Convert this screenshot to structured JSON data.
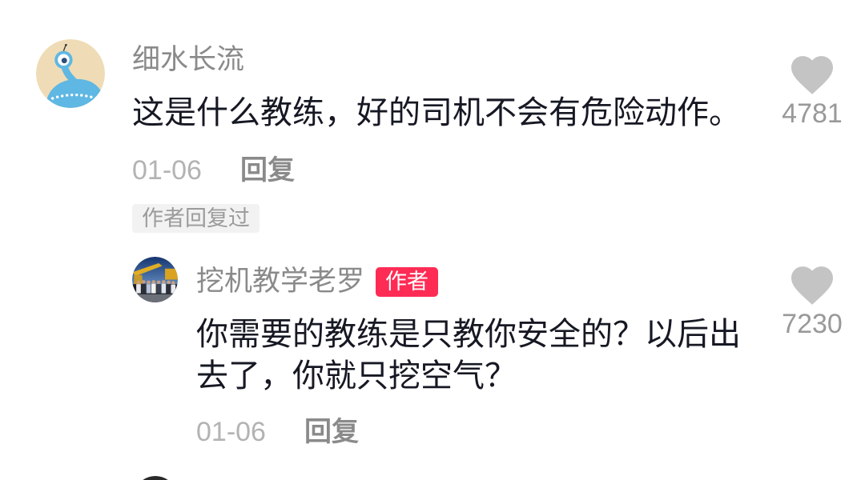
{
  "comments": [
    {
      "username": "细水长流",
      "text": "这是什么教练，好的司机不会有危险动作。",
      "date": "01-06",
      "reply_button_label": "回复",
      "like_count": "4781",
      "author_replied_tag": "作者回复过",
      "replies": [
        {
          "username": "挖机教学老罗",
          "author_badge": "作者",
          "text": "你需要的教练是只教你安全的？以后出去了，你就只挖空气？",
          "date": "01-06",
          "reply_button_label": "回复",
          "like_count": "7230"
        }
      ]
    }
  ],
  "icons": {
    "like": "heart-icon"
  },
  "colors": {
    "background": "#ffffff",
    "text_primary": "#161823",
    "username": "#8a8a8a",
    "meta": "#b3b3b3",
    "reply_label": "#8a8a8a",
    "like_icon": "#c4c4c4",
    "like_count": "#999999",
    "author_badge": "#fe2c55",
    "tag_background": "#f2f2f2",
    "tag_text": "#9b9b9b"
  }
}
